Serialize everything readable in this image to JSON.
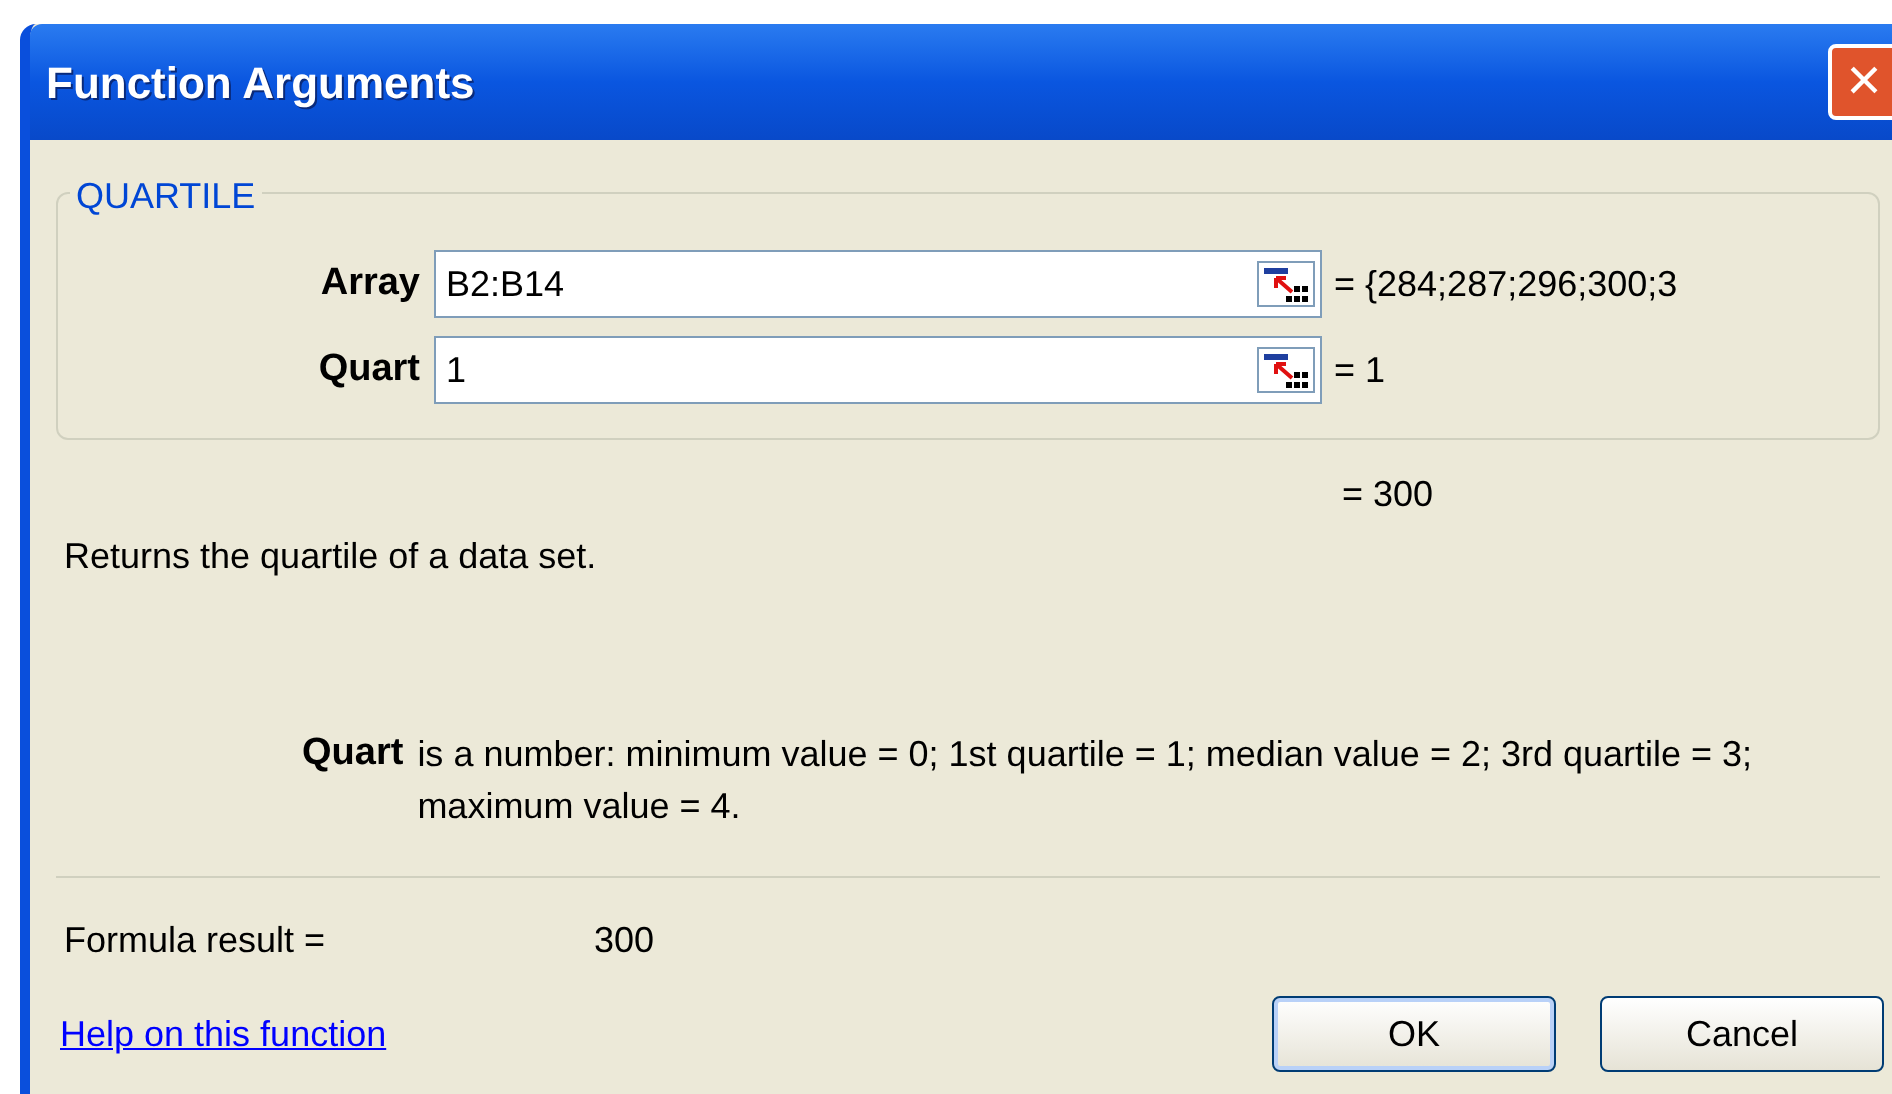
{
  "window": {
    "title": "Function Arguments",
    "close_label": "×"
  },
  "function_group": {
    "legend": "QUARTILE",
    "arguments": [
      {
        "label": "Array",
        "value": "B2:B14",
        "result": "= {284;287;296;300;3"
      },
      {
        "label": "Quart",
        "value": "1",
        "result": "= 1"
      }
    ]
  },
  "function_result": "= 300",
  "description": "Returns the quartile of a data set.",
  "argument_help": {
    "label": "Quart",
    "text": "is a number: minimum value = 0; 1st quartile = 1; median value = 2; 3rd quartile = 3; maximum value = 4."
  },
  "formula_result": {
    "label": "Formula result =",
    "value": "300"
  },
  "help_link": "Help on this function",
  "buttons": [
    {
      "label": "OK",
      "default": true
    },
    {
      "label": "Cancel",
      "default": false
    }
  ]
}
